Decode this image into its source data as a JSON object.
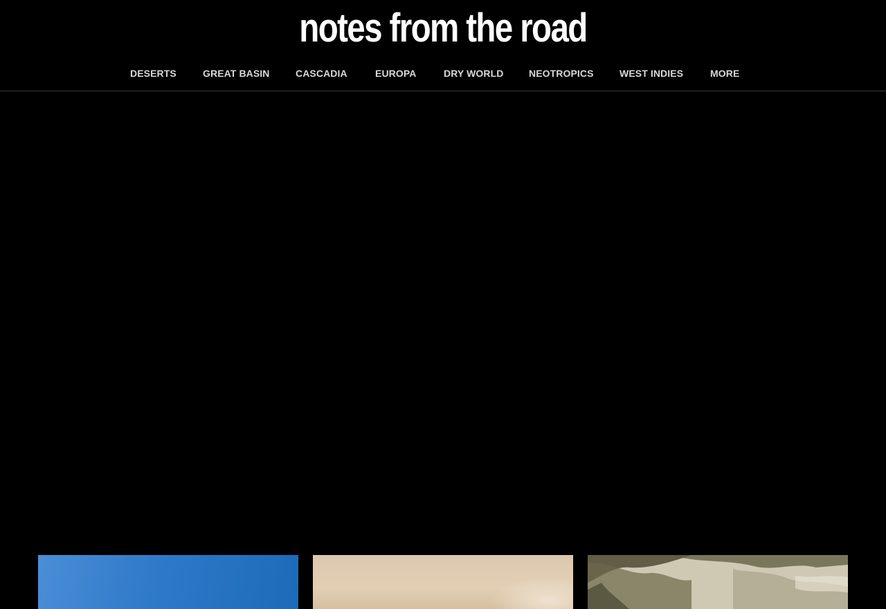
{
  "header": {
    "logo_text": "notes from the road"
  },
  "nav": {
    "items": [
      {
        "label": "DESERTS"
      },
      {
        "label": "GREAT BASIN"
      },
      {
        "label": "CASCADIA"
      },
      {
        "label": "EUROPA"
      },
      {
        "label": "DRY WORLD"
      },
      {
        "label": "NEOTROPICS"
      },
      {
        "label": "WEST INDIES"
      },
      {
        "label": "MORE"
      }
    ]
  },
  "colors": {
    "background": "#000000",
    "nav_text": "#d9d9d9",
    "logo_text": "#ffffff",
    "divider": "#3a3a3a"
  }
}
